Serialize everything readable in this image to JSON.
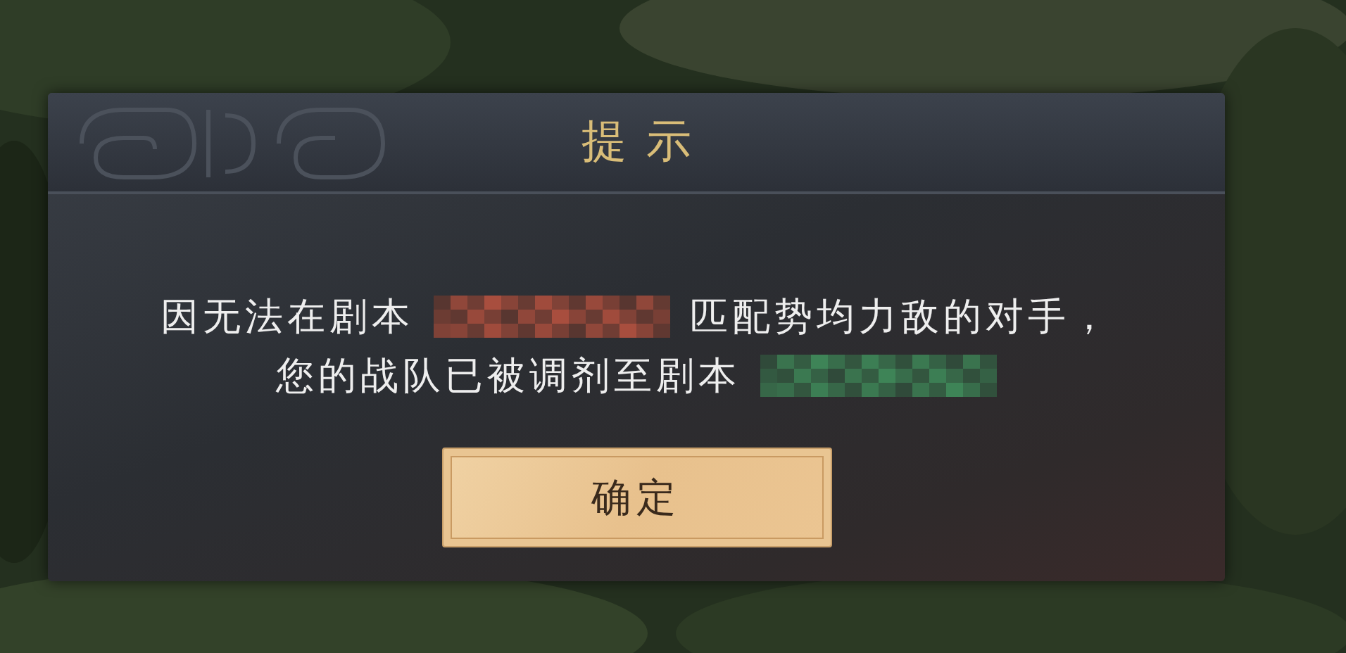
{
  "dialog": {
    "title": "提示",
    "message_lines": [
      {
        "segments": [
          {
            "kind": "text",
            "text": "因无法在剧本"
          },
          {
            "kind": "redacted",
            "color": "#b0503f"
          },
          {
            "kind": "text",
            "text": "匹配势均力敌的对手，"
          }
        ]
      },
      {
        "segments": [
          {
            "kind": "text",
            "text": "您的战队已被调剂至剧本"
          },
          {
            "kind": "redacted",
            "color": "#3f8a5a"
          }
        ]
      }
    ],
    "buttons": [
      {
        "label": "确定"
      }
    ]
  }
}
